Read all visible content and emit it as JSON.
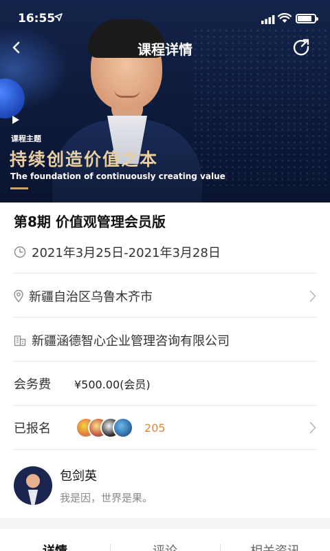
{
  "status_bar": {
    "time": "16:55"
  },
  "nav": {
    "title": "课程详情"
  },
  "banner": {
    "topic_label": "课程主题",
    "topic_title": "持续创造价值之本",
    "topic_subtitle": "The foundation of continuously creating value"
  },
  "course": {
    "title": "第8期 价值观管理会员版",
    "date_range": "2021年3月25日-2021年3月28日",
    "location": "新疆自治区乌鲁木齐市",
    "organizer": "新疆涵德智心企业管理咨询有限公司",
    "fee_label": "会务费",
    "fee_value": "¥500.00(会员)",
    "registered_label": "已报名",
    "registered_count": "205"
  },
  "author": {
    "name": "包剑英",
    "motto": "我是因，世界是果。"
  },
  "tabs": [
    {
      "label": "详情"
    },
    {
      "label": "评论"
    },
    {
      "label": "相关资讯"
    }
  ]
}
